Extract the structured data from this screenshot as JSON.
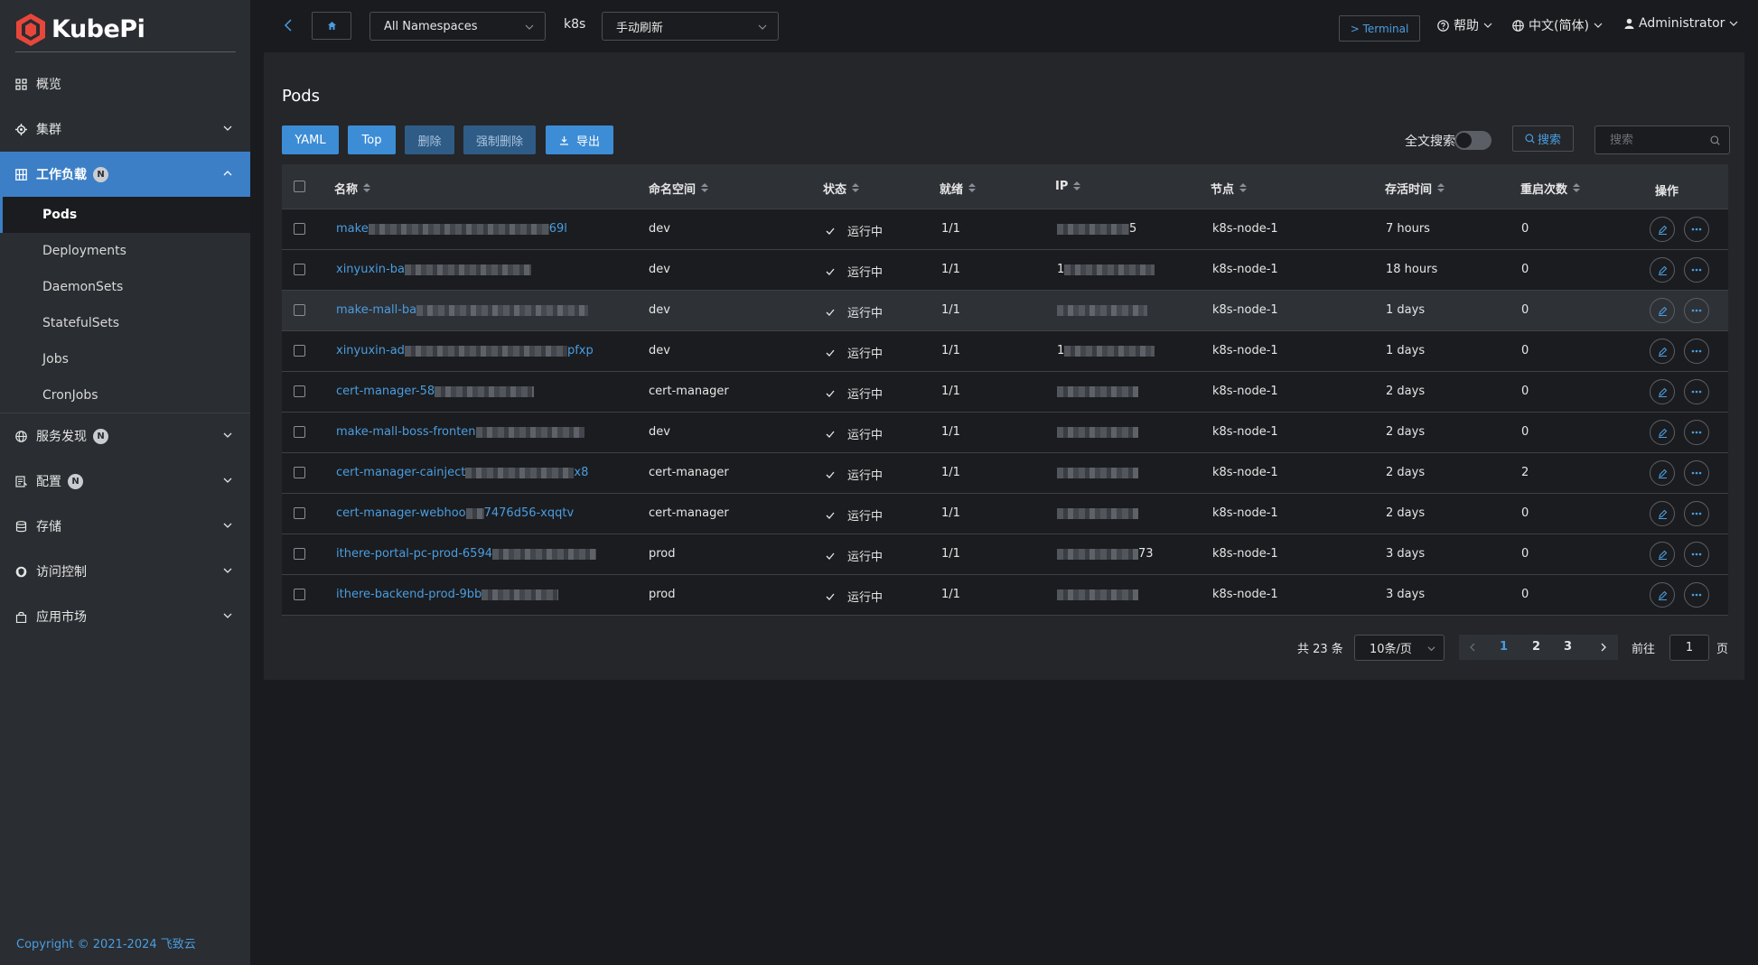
{
  "brand": {
    "name": "KubePi",
    "accent": "#3c8dd6"
  },
  "sidebar": {
    "items": [
      {
        "label": "概览",
        "icon": "dashboard-icon"
      },
      {
        "label": "集群",
        "icon": "cluster-icon"
      },
      {
        "label": "工作负载",
        "icon": "workload-icon",
        "badge": "N",
        "expanded": true
      },
      {
        "label": "服务发现",
        "icon": "globe-icon",
        "badge": "N"
      },
      {
        "label": "配置",
        "icon": "config-icon",
        "badge": "N"
      },
      {
        "label": "存储",
        "icon": "storage-icon"
      },
      {
        "label": "访问控制",
        "icon": "shield-icon"
      },
      {
        "label": "应用市场",
        "icon": "bag-icon"
      }
    ],
    "submenu": [
      "Pods",
      "Deployments",
      "DaemonSets",
      "StatefulSets",
      "Jobs",
      "CronJobs"
    ],
    "copyright": "Copyright © 2021-2024 飞致云"
  },
  "topbar": {
    "namespace": "All Namespaces",
    "cluster": "k8s",
    "refresh": "手动刷新",
    "terminal": "> Terminal",
    "help": "帮助",
    "language": "中文(简体)",
    "user": "Administrator"
  },
  "page": {
    "title": "Pods",
    "buttons": {
      "yaml": "YAML",
      "top": "Top",
      "delete": "删除",
      "force_delete": "强制删除",
      "export": "导出"
    },
    "fulltext_label": "全文搜索",
    "search_button": "搜索",
    "search_placeholder": "搜索"
  },
  "table": {
    "columns": [
      "名称",
      "命名空间",
      "状态",
      "就绪",
      "IP",
      "节点",
      "存活时间",
      "重启次数",
      "操作"
    ],
    "rows": [
      {
        "name_prefix": "make",
        "name_suffix": "69l",
        "namespace": "dev",
        "status": "运行中",
        "ready": "1/1",
        "ip_prefix": "",
        "ip_suffix": "5",
        "node": "k8s-node-1",
        "age": "7 hours",
        "restarts": "0"
      },
      {
        "name_prefix": "xinyuxin-ba",
        "name_suffix": "",
        "namespace": "dev",
        "status": "运行中",
        "ready": "1/1",
        "ip_prefix": "1",
        "ip_suffix": "",
        "node": "k8s-node-1",
        "age": "18 hours",
        "restarts": "0"
      },
      {
        "name_prefix": "make-mall-ba",
        "name_suffix": "",
        "namespace": "dev",
        "status": "运行中",
        "ready": "1/1",
        "ip_prefix": "",
        "ip_suffix": "",
        "node": "k8s-node-1",
        "age": "1 days",
        "restarts": "0"
      },
      {
        "name_prefix": "xinyuxin-ad",
        "name_suffix": "pfxp",
        "namespace": "dev",
        "status": "运行中",
        "ready": "1/1",
        "ip_prefix": "1",
        "ip_suffix": "",
        "node": "k8s-node-1",
        "age": "1 days",
        "restarts": "0"
      },
      {
        "name_prefix": "cert-manager-58",
        "name_suffix": "",
        "namespace": "cert-manager",
        "status": "运行中",
        "ready": "1/1",
        "ip_prefix": "",
        "ip_suffix": "",
        "node": "k8s-node-1",
        "age": "2 days",
        "restarts": "0"
      },
      {
        "name_prefix": "make-mall-boss-fronten",
        "name_suffix": "",
        "namespace": "dev",
        "status": "运行中",
        "ready": "1/1",
        "ip_prefix": "",
        "ip_suffix": "",
        "node": "k8s-node-1",
        "age": "2 days",
        "restarts": "0"
      },
      {
        "name_prefix": "cert-manager-cainject",
        "name_suffix": "x8",
        "namespace": "cert-manager",
        "status": "运行中",
        "ready": "1/1",
        "ip_prefix": "",
        "ip_suffix": "",
        "node": "k8s-node-1",
        "age": "2 days",
        "restarts": "2"
      },
      {
        "name_prefix": "cert-manager-webhoo",
        "name_suffix": "7476d56-xqqtv",
        "namespace": "cert-manager",
        "status": "运行中",
        "ready": "1/1",
        "ip_prefix": "",
        "ip_suffix": "",
        "node": "k8s-node-1",
        "age": "2 days",
        "restarts": "0"
      },
      {
        "name_prefix": "ithere-portal-pc-prod-6594",
        "name_suffix": "",
        "namespace": "prod",
        "status": "运行中",
        "ready": "1/1",
        "ip_prefix": "",
        "ip_suffix": "73",
        "node": "k8s-node-1",
        "age": "3 days",
        "restarts": "0"
      },
      {
        "name_prefix": "ithere-backend-prod-9bb",
        "name_suffix": "",
        "namespace": "prod",
        "status": "运行中",
        "ready": "1/1",
        "ip_prefix": "",
        "ip_suffix": "",
        "node": "k8s-node-1",
        "age": "3 days",
        "restarts": "0"
      }
    ]
  },
  "pagination": {
    "total": "共 23 条",
    "page_size": "10条/页",
    "pages": [
      "1",
      "2",
      "3"
    ],
    "current_page": "1",
    "goto_label": "前往",
    "goto_value": "1",
    "goto_suffix": "页"
  }
}
